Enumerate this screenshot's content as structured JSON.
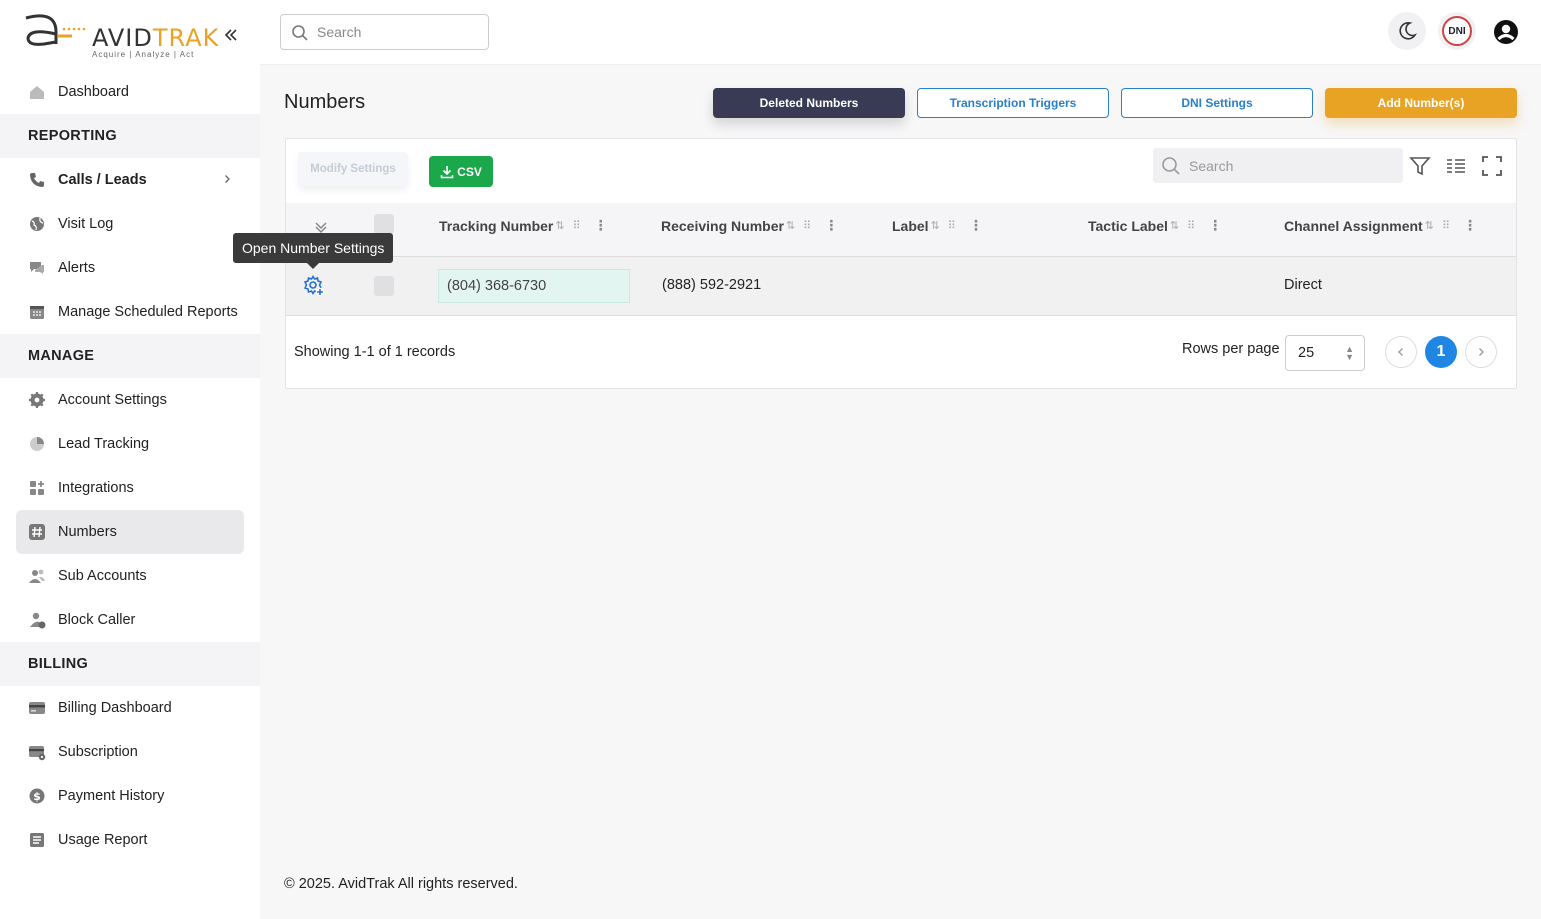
{
  "brand": {
    "name_part1": "AVID",
    "name_part2": "TRAK",
    "tagline": "Acquire  |  Analyze  |  Act",
    "colors": {
      "accent": "#e8a324",
      "primary_dark": "#393a54",
      "link": "#2a7fc9",
      "success": "#1aa84a",
      "pager_active": "#1f86e3"
    }
  },
  "sidebar": {
    "collapse_icon": "double-chevron-left-icon",
    "items": [
      {
        "kind": "item",
        "label": "Dashboard",
        "icon": "home-icon"
      },
      {
        "kind": "section",
        "label": "REPORTING"
      },
      {
        "kind": "item",
        "label": "Calls / Leads",
        "icon": "phone-icon",
        "bold": true,
        "has_chevron": true
      },
      {
        "kind": "item",
        "label": "Visit Log",
        "icon": "globe-icon"
      },
      {
        "kind": "item",
        "label": "Alerts",
        "icon": "chat-icon"
      },
      {
        "kind": "item",
        "label": "Manage Scheduled Reports",
        "icon": "calendar-icon"
      },
      {
        "kind": "section",
        "label": "MANAGE"
      },
      {
        "kind": "item",
        "label": "Account Settings",
        "icon": "gear-icon"
      },
      {
        "kind": "item",
        "label": "Lead Tracking",
        "icon": "pie-chart-icon"
      },
      {
        "kind": "item",
        "label": "Integrations",
        "icon": "apps-plus-icon"
      },
      {
        "kind": "item",
        "label": "Numbers",
        "icon": "hash-icon",
        "active": true
      },
      {
        "kind": "item",
        "label": "Sub Accounts",
        "icon": "users-icon"
      },
      {
        "kind": "item",
        "label": "Block Caller",
        "icon": "user-block-icon"
      },
      {
        "kind": "section",
        "label": "BILLING"
      },
      {
        "kind": "item",
        "label": "Billing Dashboard",
        "icon": "credit-card-icon"
      },
      {
        "kind": "item",
        "label": "Subscription",
        "icon": "card-gear-icon"
      },
      {
        "kind": "item",
        "label": "Payment History",
        "icon": "dollar-circle-icon"
      },
      {
        "kind": "item",
        "label": "Usage Report",
        "icon": "report-icon"
      }
    ]
  },
  "topbar": {
    "search_placeholder": "Search",
    "theme_icon": "moon-icon",
    "dni_label": "DNI",
    "profile_icon": "account-circle-icon"
  },
  "page": {
    "title": "Numbers",
    "buttons": {
      "deleted_numbers": "Deleted Numbers",
      "transcription_triggers": "Transcription Triggers",
      "dni_settings": "DNI Settings",
      "add_numbers": "Add Number(s)"
    }
  },
  "table": {
    "modify_settings_label": "Modify Settings",
    "csv_label": "CSV",
    "search_placeholder": "Search",
    "tools": [
      "filter-icon",
      "columns-icon",
      "fullscreen-icon"
    ],
    "columns": [
      "Tracking Number",
      "Receiving Number",
      "Label",
      "Tactic Label",
      "Channel Assignment"
    ],
    "rows": [
      {
        "tracking_number": "(804) 368-6730",
        "receiving_number": "(888) 592-2921",
        "label": "",
        "tactic_label": "",
        "channel_assignment": "Direct"
      }
    ],
    "tooltip": "Open Number Settings",
    "showing_text": "Showing 1-1 of 1 records",
    "rows_per_page_label": "Rows per page",
    "rows_per_page_value": "25",
    "current_page": "1"
  },
  "footer": {
    "copyright": "© 2025. AvidTrak All rights reserved."
  }
}
